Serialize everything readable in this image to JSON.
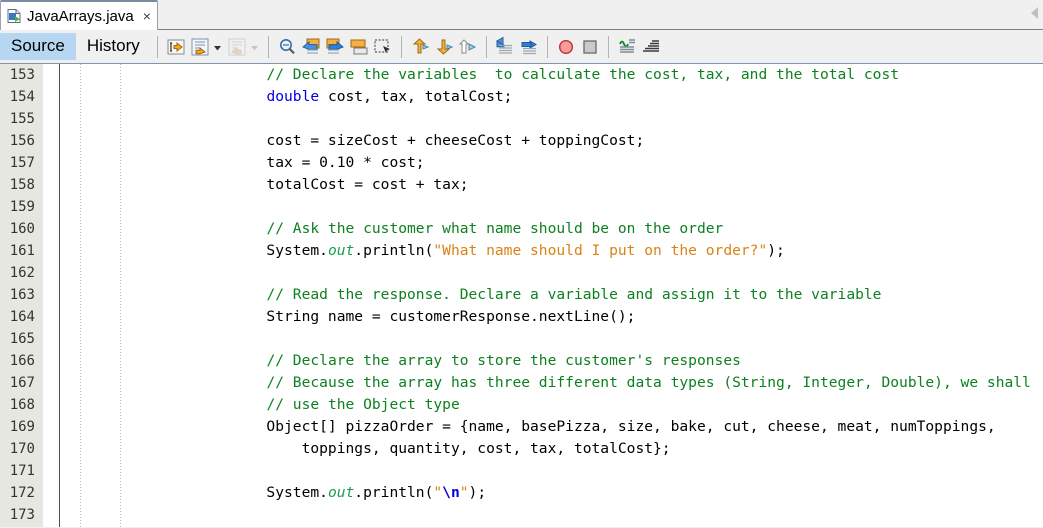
{
  "window": {
    "document_tab": {
      "title": "JavaArrays.java",
      "close_label": "×",
      "icon": "java-file-icon"
    },
    "tab_scroll_icon": "scroll-tabs-left-icon"
  },
  "view_tabs": [
    {
      "label": "Source",
      "selected": true
    },
    {
      "label": "History",
      "selected": false
    }
  ],
  "toolbar": {
    "groups": [
      {
        "name": "navigation",
        "buttons": [
          {
            "name": "last-edit-position-icon",
            "enabled": true,
            "dropdown": false
          },
          {
            "name": "back-icon",
            "enabled": true,
            "dropdown": true
          },
          {
            "name": "forward-icon",
            "enabled": false,
            "dropdown": true
          }
        ]
      },
      {
        "name": "find-replace",
        "buttons": [
          {
            "name": "find-selection-icon",
            "enabled": true,
            "dropdown": false
          },
          {
            "name": "find-previous-icon",
            "enabled": true,
            "dropdown": false
          },
          {
            "name": "find-next-icon",
            "enabled": true,
            "dropdown": false
          },
          {
            "name": "toggle-highlight-icon",
            "enabled": true,
            "dropdown": false
          },
          {
            "name": "toggle-rectangular-selection-icon",
            "enabled": true,
            "dropdown": false
          }
        ]
      },
      {
        "name": "bookmarks",
        "buttons": [
          {
            "name": "previous-bookmark-icon",
            "enabled": true,
            "dropdown": false
          },
          {
            "name": "next-bookmark-icon",
            "enabled": true,
            "dropdown": false
          },
          {
            "name": "toggle-bookmark-icon",
            "enabled": true,
            "dropdown": false
          }
        ]
      },
      {
        "name": "indentation",
        "buttons": [
          {
            "name": "shift-line-left-icon",
            "enabled": true,
            "dropdown": false
          },
          {
            "name": "shift-line-right-icon",
            "enabled": true,
            "dropdown": false
          }
        ]
      },
      {
        "name": "debug",
        "buttons": [
          {
            "name": "toggle-breakpoint-icon",
            "enabled": true,
            "dropdown": false
          },
          {
            "name": "stop-icon",
            "enabled": true,
            "dropdown": false
          }
        ]
      },
      {
        "name": "formatting",
        "buttons": [
          {
            "name": "inspect-members-icon",
            "enabled": true,
            "dropdown": false
          },
          {
            "name": "comment-lines-icon",
            "enabled": true,
            "dropdown": false
          }
        ]
      }
    ]
  },
  "editor": {
    "first_line": 153,
    "lines": [
      {
        "n": 153,
        "tokens": [
          {
            "t": "            ",
            "c": "plain"
          },
          {
            "t": "// Declare the variables  to calculate the cost, tax, and the total cost",
            "c": "comment"
          }
        ]
      },
      {
        "n": 154,
        "tokens": [
          {
            "t": "            ",
            "c": "plain"
          },
          {
            "t": "double",
            "c": "keyword"
          },
          {
            "t": " cost, tax, totalCost;",
            "c": "plain"
          }
        ]
      },
      {
        "n": 155,
        "tokens": []
      },
      {
        "n": 156,
        "tokens": [
          {
            "t": "            cost = sizeCost + cheeseCost + toppingCost;",
            "c": "plain"
          }
        ]
      },
      {
        "n": 157,
        "tokens": [
          {
            "t": "            tax = 0.10 * cost;",
            "c": "plain"
          }
        ]
      },
      {
        "n": 158,
        "tokens": [
          {
            "t": "            totalCost = cost + tax;",
            "c": "plain"
          }
        ]
      },
      {
        "n": 159,
        "tokens": []
      },
      {
        "n": 160,
        "tokens": [
          {
            "t": "            ",
            "c": "plain"
          },
          {
            "t": "// Ask the customer what name should be on the order",
            "c": "comment"
          }
        ]
      },
      {
        "n": 161,
        "tokens": [
          {
            "t": "            System.",
            "c": "plain"
          },
          {
            "t": "out",
            "c": "field"
          },
          {
            "t": ".println(",
            "c": "plain"
          },
          {
            "t": "\"What name should I put on the order?\"",
            "c": "string"
          },
          {
            "t": ");",
            "c": "plain"
          }
        ]
      },
      {
        "n": 162,
        "tokens": []
      },
      {
        "n": 163,
        "tokens": [
          {
            "t": "            ",
            "c": "plain"
          },
          {
            "t": "// Read the response. Declare a variable and assign it to the variable",
            "c": "comment"
          }
        ]
      },
      {
        "n": 164,
        "tokens": [
          {
            "t": "            String name = customerResponse.nextLine();",
            "c": "plain"
          }
        ]
      },
      {
        "n": 165,
        "tokens": []
      },
      {
        "n": 166,
        "tokens": [
          {
            "t": "            ",
            "c": "plain"
          },
          {
            "t": "// Declare the array to store the customer's responses",
            "c": "comment"
          }
        ]
      },
      {
        "n": 167,
        "tokens": [
          {
            "t": "            ",
            "c": "plain"
          },
          {
            "t": "// Because the array has three different data types (String, Integer, Double), we shall",
            "c": "comment"
          }
        ]
      },
      {
        "n": 168,
        "tokens": [
          {
            "t": "            ",
            "c": "plain"
          },
          {
            "t": "// use the Object type",
            "c": "comment"
          }
        ]
      },
      {
        "n": 169,
        "tokens": [
          {
            "t": "            Object[] pizzaOrder = {name, basePizza, size, bake, cut, cheese, meat, numToppings,",
            "c": "plain"
          }
        ]
      },
      {
        "n": 170,
        "tokens": [
          {
            "t": "                toppings, quantity, cost, tax, totalCost};",
            "c": "plain"
          }
        ]
      },
      {
        "n": 171,
        "tokens": []
      },
      {
        "n": 172,
        "tokens": [
          {
            "t": "            System.",
            "c": "plain"
          },
          {
            "t": "out",
            "c": "field"
          },
          {
            "t": ".println(",
            "c": "plain"
          },
          {
            "t": "\"",
            "c": "string"
          },
          {
            "t": "\\n",
            "c": "escape"
          },
          {
            "t": "\"",
            "c": "string"
          },
          {
            "t": ");",
            "c": "plain"
          }
        ]
      },
      {
        "n": 173,
        "tokens": []
      }
    ]
  },
  "colors": {
    "comment": "#0e8020",
    "keyword": "#0000e6",
    "string": "#d98216",
    "field": "#1a9e52",
    "escape": "#0000d0",
    "gutter_bg": "#e7e7e2",
    "selected_tab_bg": "#b7d6f2",
    "chrome_bg": "#f0f0f0"
  }
}
